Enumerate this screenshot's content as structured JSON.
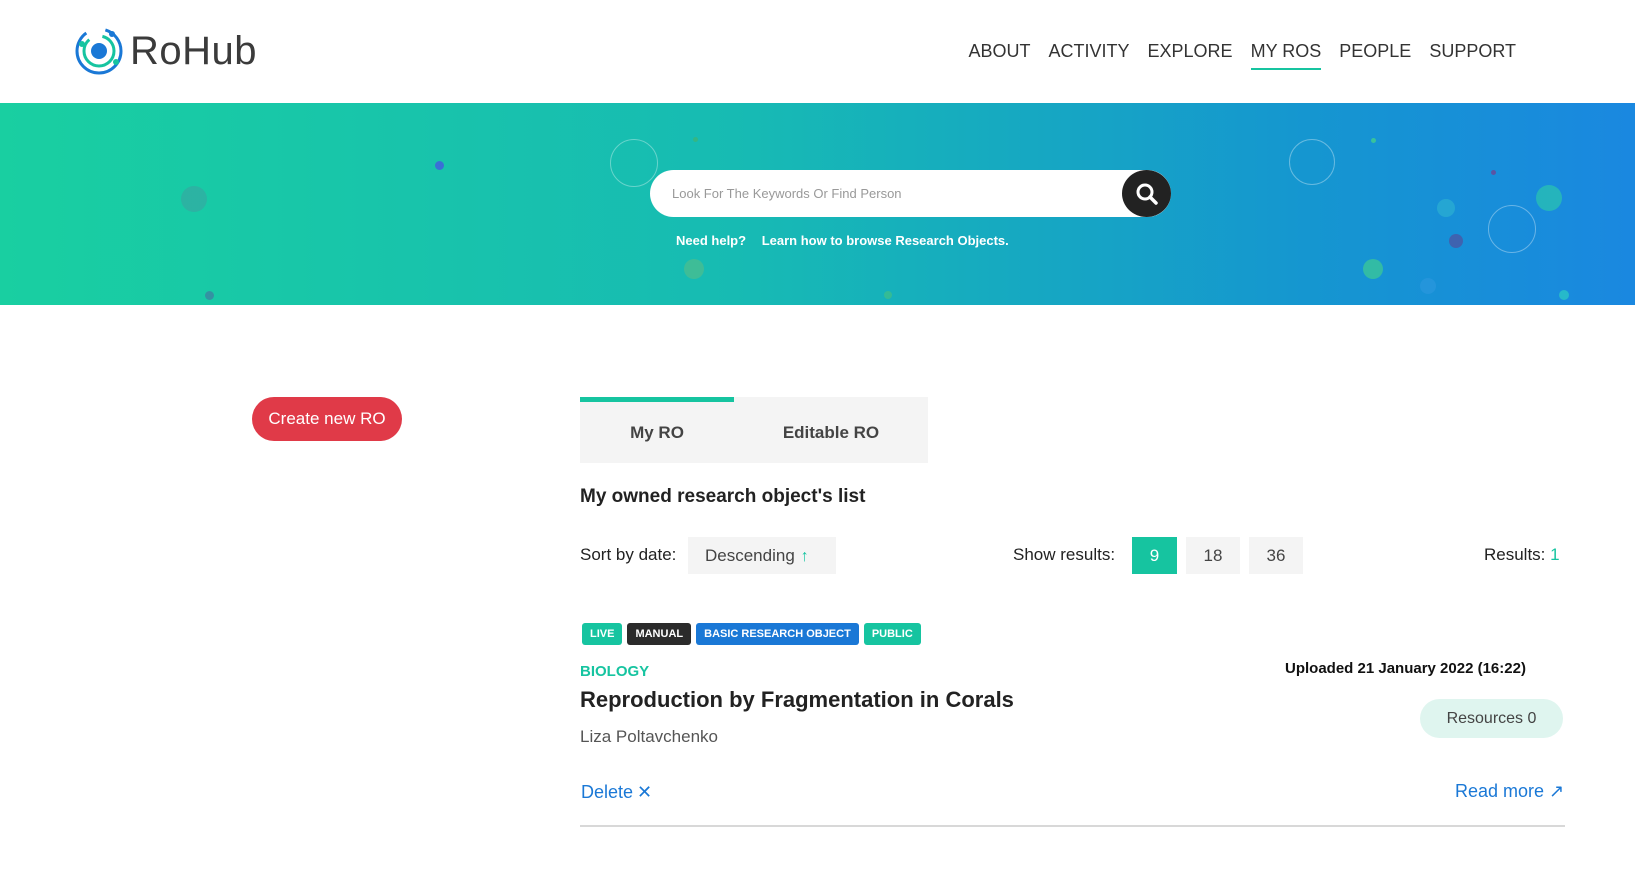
{
  "brand": {
    "name": "RoHub",
    "accent": "#16c4a0"
  },
  "nav": {
    "items": [
      {
        "label": "ABOUT"
      },
      {
        "label": "ACTIVITY"
      },
      {
        "label": "EXPLORE"
      },
      {
        "label": "MY ROS",
        "active": true
      },
      {
        "label": "PEOPLE"
      },
      {
        "label": "SUPPORT"
      }
    ]
  },
  "hero": {
    "search_placeholder": "Look For The Keywords Or Find Person",
    "search_icon": "search-icon",
    "help_label": "Need help?",
    "help_link": "Learn how to browse Research Objects."
  },
  "main": {
    "create_button": "Create new RO",
    "tabs": [
      {
        "label": "My RO",
        "active": true
      },
      {
        "label": "Editable RO"
      }
    ],
    "list_title": "My owned research object's list",
    "sort_label": "Sort by date:",
    "sort_value": "Descending",
    "sort_icon": "arrow-up-icon",
    "show_label": "Show results:",
    "page_sizes": [
      "9",
      "18",
      "36"
    ],
    "active_page_size": "9",
    "results_label": "Results:",
    "results_count": "1"
  },
  "ro_item": {
    "badges": [
      {
        "label": "LIVE",
        "color": "#16c4a0"
      },
      {
        "label": "MANUAL",
        "color": "#2b2b2b"
      },
      {
        "label": "BASIC RESEARCH OBJECT",
        "color": "#1a78d6"
      },
      {
        "label": "PUBLIC",
        "color": "#16c4a0"
      }
    ],
    "category": "BIOLOGY",
    "title": "Reproduction by Fragmentation in Corals",
    "author": "Liza Poltavchenko",
    "uploaded": "Uploaded  21 January 2022 (16:22)",
    "resources": "Resources 0",
    "delete_label": "Delete",
    "delete_icon": "close-icon",
    "read_more": "Read more",
    "read_more_icon": "external-arrow-icon"
  }
}
